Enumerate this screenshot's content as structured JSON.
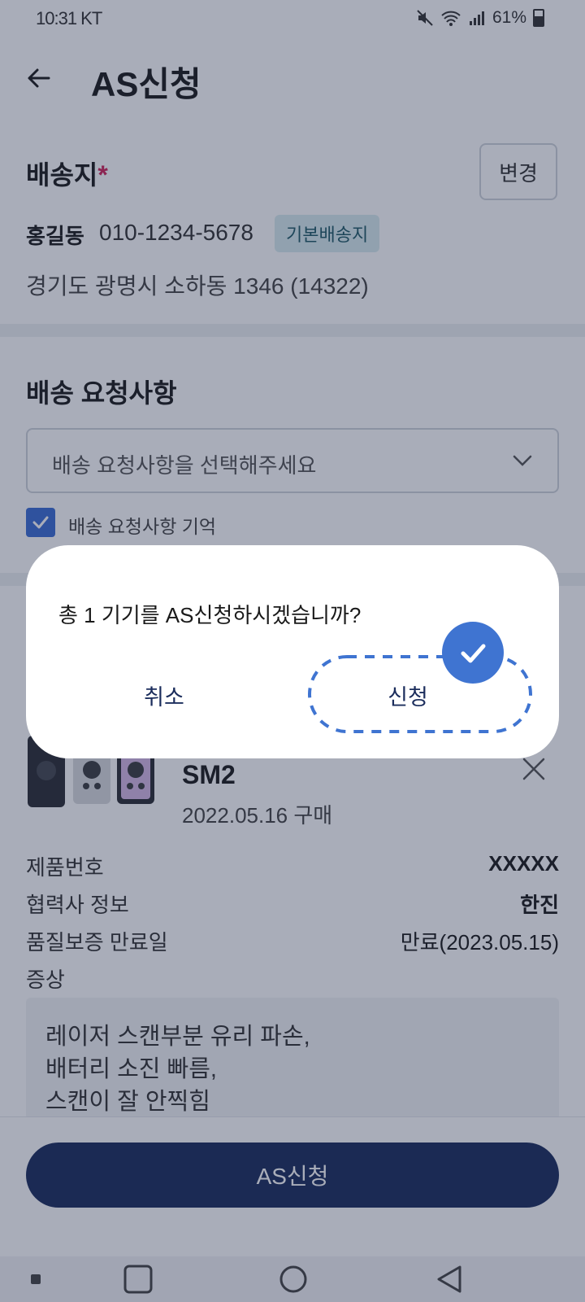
{
  "status_bar": {
    "time": "10:31 KT",
    "battery": "61%"
  },
  "header": {
    "title": "AS신청"
  },
  "shipping": {
    "title": "배송지",
    "required_mark": "*",
    "change_label": "변경",
    "name": "홍길동",
    "phone": "010-1234-5678",
    "default_badge": "기본배송지",
    "address": "경기도 광명시 소하동 1346 (14322)"
  },
  "delivery_request": {
    "title": "배송 요청사항",
    "dropdown_placeholder": "배송 요청사항을 선택해주세요",
    "remember_label": "배송 요청사항 기억",
    "remember_checked": true
  },
  "product": {
    "name": "SM2",
    "purchase_date": "2022.05.16 구매",
    "rows": [
      {
        "label": "제품번호",
        "value": "XXXXX"
      },
      {
        "label": "협력사 정보",
        "value": "한진"
      },
      {
        "label": "품질보증 만료일",
        "value": "만료(2023.05.15)"
      }
    ],
    "symptom_label": "증상",
    "symptom_text": "레이저 스캔부분 유리 파손,\n배터리 소진 빠름,\n스캔이 잘 안찍힘"
  },
  "footer": {
    "submit_label": "AS신청"
  },
  "dialog": {
    "message": "총 1 기기를 AS신청하시겠습니까?",
    "cancel_label": "취소",
    "confirm_label": "신청"
  },
  "colors": {
    "accent": "#3f74d1",
    "primary_button": "#1b2d5c",
    "required": "#d0245a",
    "badge_bg": "#d9ecef"
  },
  "icons": {
    "back": "arrow-left-icon",
    "dropdown": "chevron-down-icon",
    "remove": "close-icon",
    "check": "check-icon"
  }
}
